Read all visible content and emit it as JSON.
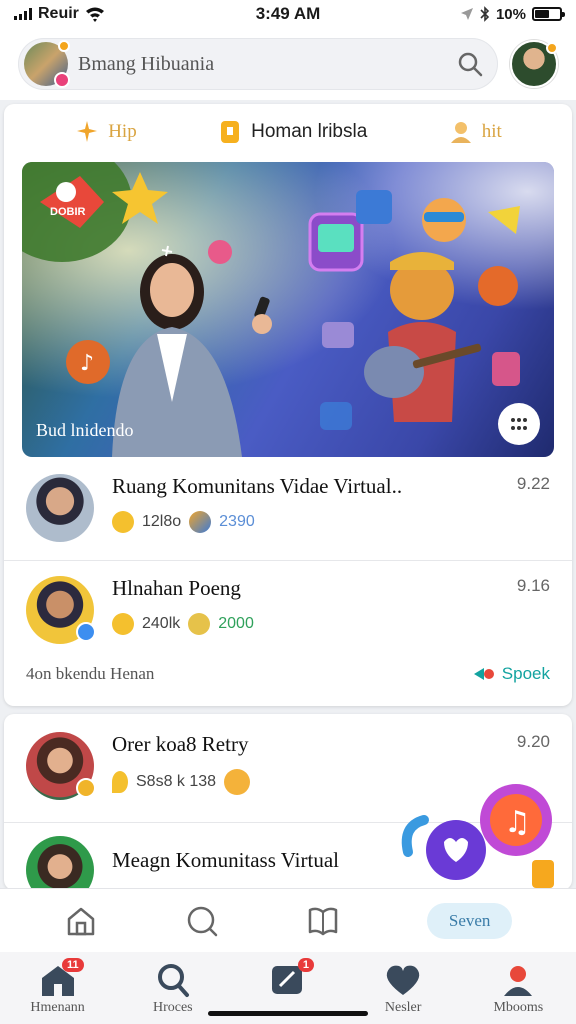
{
  "status_bar": {
    "carrier": "Reuir",
    "time": "3:49 AM",
    "battery": "10%"
  },
  "header": {
    "search_text": "Bmang Hibuania"
  },
  "tabs": [
    {
      "label": "Hip"
    },
    {
      "label": "Homan lribsla"
    },
    {
      "label": "hit"
    }
  ],
  "banner": {
    "label": "Bud lnidendo",
    "sticker": "DOBIR"
  },
  "feed": [
    {
      "title": "Ruang Komunitans Vidae Virtual..",
      "time": "9.22",
      "stat1": "12l8o",
      "stat2": "2390"
    },
    {
      "title": "Hlnahan Poeng",
      "time": "9.16",
      "stat1": "240lk",
      "stat2": "2000"
    },
    {
      "title": "Orer koa8 Retry",
      "time": "9.20",
      "stat1": "S8s8 k 138"
    },
    {
      "title": "Meagn Komunitass Virtual"
    }
  ],
  "footer": {
    "left": "4on bkendu Henan",
    "right": "Spoek"
  },
  "subnav": {
    "pill": "Seven"
  },
  "tabbar": [
    {
      "label": "Hmenann",
      "icon": "home-icon",
      "badge": "11"
    },
    {
      "label": "Hroces",
      "icon": "search-icon"
    },
    {
      "label": "",
      "icon": "edit-icon",
      "badge": "1"
    },
    {
      "label": "Nesler",
      "icon": "heart-icon"
    },
    {
      "label": "Mbooms",
      "icon": "people-icon"
    }
  ],
  "colors": {
    "accent": "#13a3a0",
    "badge": "#e83a3a",
    "gold": "#d9a441"
  }
}
